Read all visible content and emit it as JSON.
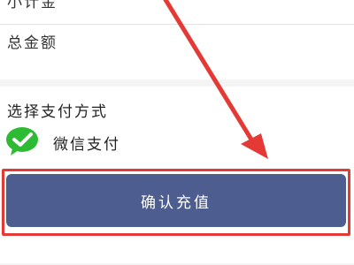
{
  "rows": {
    "partial_label": "小计金",
    "total_label": "总金额"
  },
  "payment": {
    "section_title": "选择支付方式",
    "method_label": "微信支付"
  },
  "confirm": {
    "label": "确认充值"
  },
  "colors": {
    "button": "#4e5d8f",
    "highlight": "#e53935",
    "wechat": "#2dbb33"
  }
}
